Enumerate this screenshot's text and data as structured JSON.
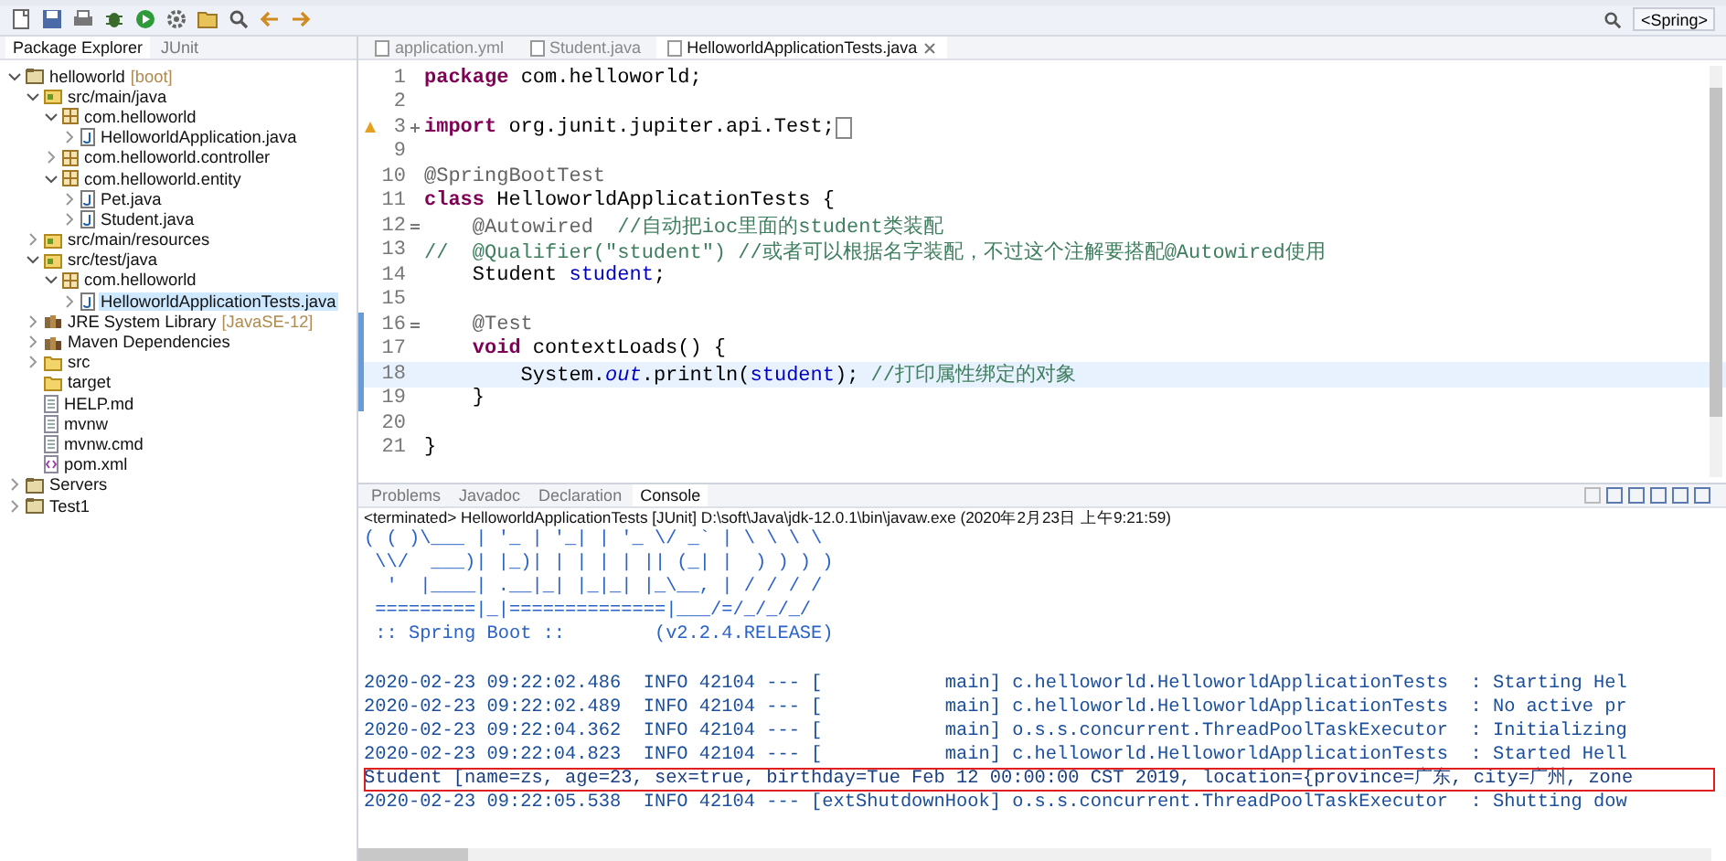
{
  "toolbar": {
    "perspective": "<Spring>"
  },
  "explorer": {
    "tabs": [
      {
        "label": "Package Explorer",
        "selected": true
      },
      {
        "label": "JUnit",
        "selected": false
      }
    ],
    "tree": [
      {
        "kind": "project",
        "label": "helloworld",
        "decoration": "[boot]",
        "expanded": true,
        "selected": false,
        "children": [
          {
            "kind": "source_folder",
            "label": "src/main/java",
            "expanded": true,
            "selected": false,
            "children": [
              {
                "kind": "package",
                "label": "com.helloworld",
                "expanded": true,
                "selected": false,
                "children": [
                  {
                    "kind": "java",
                    "label": "HelloworldApplication.java",
                    "expanded": false,
                    "selected": false
                  }
                ]
              },
              {
                "kind": "package",
                "label": "com.helloworld.controller",
                "expanded": false,
                "selected": false
              },
              {
                "kind": "package",
                "label": "com.helloworld.entity",
                "expanded": true,
                "selected": false,
                "children": [
                  {
                    "kind": "java",
                    "label": "Pet.java",
                    "expanded": false,
                    "selected": false
                  },
                  {
                    "kind": "java",
                    "label": "Student.java",
                    "expanded": false,
                    "selected": false
                  }
                ]
              }
            ]
          },
          {
            "kind": "source_folder",
            "label": "src/main/resources",
            "expanded": false,
            "selected": false
          },
          {
            "kind": "source_folder",
            "label": "src/test/java",
            "expanded": true,
            "selected": false,
            "children": [
              {
                "kind": "package",
                "label": "com.helloworld",
                "expanded": true,
                "selected": false,
                "children": [
                  {
                    "kind": "java",
                    "label": "HelloworldApplicationTests.java",
                    "expanded": false,
                    "selected": true
                  }
                ]
              }
            ]
          },
          {
            "kind": "library",
            "label": "JRE System Library",
            "decoration": "[JavaSE-12]",
            "expanded": false,
            "selected": false
          },
          {
            "kind": "library",
            "label": "Maven Dependencies",
            "expanded": false,
            "selected": false
          },
          {
            "kind": "folder",
            "label": "src",
            "expanded": false,
            "selected": false
          },
          {
            "kind": "folder",
            "label": "target",
            "selected": false
          },
          {
            "kind": "file",
            "label": "HELP.md",
            "selected": false
          },
          {
            "kind": "file",
            "label": "mvnw",
            "selected": false
          },
          {
            "kind": "file",
            "label": "mvnw.cmd",
            "selected": false
          },
          {
            "kind": "xml",
            "label": "pom.xml",
            "selected": false
          }
        ]
      },
      {
        "kind": "project",
        "label": "Servers",
        "expanded": false,
        "selected": false
      },
      {
        "kind": "project",
        "label": "Test1",
        "expanded": false,
        "selected": false
      }
    ]
  },
  "editor": {
    "tabs": [
      {
        "label": "application.yml",
        "selected": false
      },
      {
        "label": "Student.java",
        "selected": false
      },
      {
        "label": "HelloworldApplicationTests.java",
        "selected": true
      }
    ],
    "lines": [
      {
        "number": "1",
        "tokens": [
          {
            "kind": "keyword",
            "text": "package"
          },
          {
            "kind": "plain",
            "text": " com.helloworld;"
          }
        ]
      },
      {
        "number": "2"
      },
      {
        "number": "3",
        "folded": true,
        "warning": true,
        "folded_box": true,
        "tokens": [
          {
            "kind": "keyword",
            "text": "import"
          },
          {
            "kind": "plain",
            "text": " org.junit.jupiter.api.Test;"
          }
        ]
      },
      {
        "number": "9"
      },
      {
        "number": "10",
        "tokens": [
          {
            "kind": "annotation",
            "text": "@SpringBootTest"
          }
        ]
      },
      {
        "number": "11",
        "tokens": [
          {
            "kind": "keyword",
            "text": "class"
          },
          {
            "kind": "plain",
            "text": " HelloworldApplicationTests {"
          }
        ]
      },
      {
        "number": "12",
        "folded": false,
        "tokens": [
          {
            "kind": "annotation",
            "text": "    @Autowired"
          },
          {
            "kind": "comment",
            "text": "  //自动把ioc里面的student类装配"
          }
        ]
      },
      {
        "number": "13",
        "tokens": [
          {
            "kind": "comment",
            "text": "//  @Qualifier(\"student\") //或者可以根据名字装配，不过这个注解要搭配@Autowired使用"
          }
        ]
      },
      {
        "number": "14",
        "tokens": [
          {
            "kind": "plain",
            "text": "    Student "
          },
          {
            "kind": "field",
            "text": "student"
          },
          {
            "kind": "plain",
            "text": ";"
          }
        ]
      },
      {
        "number": "15"
      },
      {
        "number": "16",
        "folded": false,
        "marked": true,
        "tokens": [
          {
            "kind": "annotation",
            "text": "    @Test"
          }
        ]
      },
      {
        "number": "17",
        "marked": true,
        "tokens": [
          {
            "kind": "keyword",
            "text": "    void"
          },
          {
            "kind": "plain",
            "text": " contextLoads() {"
          }
        ]
      },
      {
        "number": "18",
        "marked": true,
        "current": true,
        "tokens": [
          {
            "kind": "plain",
            "text": "        System."
          },
          {
            "kind": "static",
            "text": "out"
          },
          {
            "kind": "plain",
            "text": ".println("
          },
          {
            "kind": "field",
            "text": "student"
          },
          {
            "kind": "plain",
            "text": "); "
          },
          {
            "kind": "comment",
            "text": "//打印属性绑定的对象"
          }
        ]
      },
      {
        "number": "19",
        "marked": true,
        "tokens": [
          {
            "kind": "plain",
            "text": "    }"
          }
        ]
      },
      {
        "number": "20"
      },
      {
        "number": "21",
        "tokens": [
          {
            "kind": "plain",
            "text": "}"
          }
        ]
      }
    ]
  },
  "console_panel": {
    "tabs": [
      {
        "label": "Problems",
        "selected": false
      },
      {
        "label": "Javadoc",
        "selected": false
      },
      {
        "label": "Declaration",
        "selected": false
      },
      {
        "label": "Console",
        "selected": true
      }
    ],
    "header": "<terminated> HelloworldApplicationTests [JUnit] D:\\soft\\Java\\jdk-12.0.1\\bin\\javaw.exe (2020年2月23日 上午9:21:59)",
    "lines": [
      {
        "kind": "banner",
        "text": "( ( )\\___ | '_ | '_| | '_ \\/ _` | \\ \\ \\ \\",
        "boxed": false
      },
      {
        "kind": "banner",
        "text": " \\\\/  ___)| |_)| | | | | || (_| |  ) ) ) )",
        "boxed": false
      },
      {
        "kind": "banner",
        "text": "  '  |____| .__|_| |_|_| |_\\__, | / / / /",
        "boxed": false
      },
      {
        "kind": "banner",
        "text": " =========|_|==============|___/=/_/_/_/",
        "boxed": false
      },
      {
        "kind": "banner",
        "text": " :: Spring Boot ::        (v2.2.4.RELEASE)",
        "boxed": false
      },
      {
        "kind": "log",
        "text": "2020-02-23 09:22:02.486  INFO 42104 --- [           main] c.helloworld.HelloworldApplicationTests  : Starting Hel",
        "boxed": false
      },
      {
        "kind": "log",
        "text": "2020-02-23 09:22:02.489  INFO 42104 --- [           main] c.helloworld.HelloworldApplicationTests  : No active pr",
        "boxed": false
      },
      {
        "kind": "log",
        "text": "2020-02-23 09:22:04.362  INFO 42104 --- [           main] o.s.s.concurrent.ThreadPoolTaskExecutor  : Initializing",
        "boxed": false
      },
      {
        "kind": "log",
        "text": "2020-02-23 09:22:04.823  INFO 42104 --- [           main] c.helloworld.HelloworldApplicationTests  : Started Hell",
        "boxed": false
      },
      {
        "kind": "log",
        "text": "Student [name=zs, age=23, sex=true, birthday=Tue Feb 12 00:00:00 CST 2019, location={province=广东, city=广州, zone",
        "boxed": true
      },
      {
        "kind": "log",
        "text": "2020-02-23 09:22:05.538  INFO 42104 --- [extShutdownHook] o.s.s.concurrent.ThreadPoolTaskExecutor  : Shutting dow",
        "boxed": false
      }
    ]
  }
}
